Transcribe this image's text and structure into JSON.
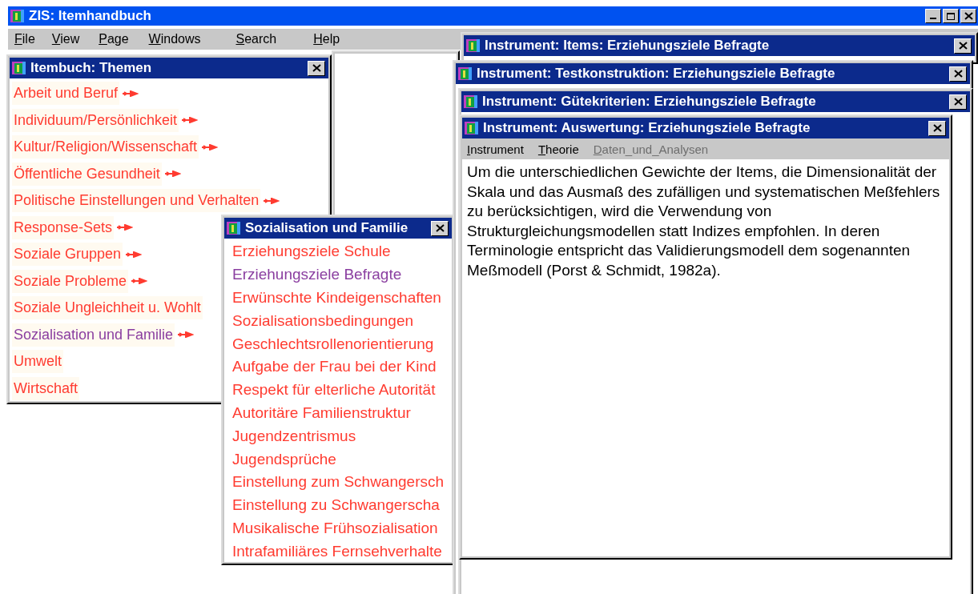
{
  "app": {
    "title": "ZIS: Itemhandbuch"
  },
  "menu": [
    "File",
    "View",
    "Page",
    "Windows",
    "Search",
    "Help"
  ],
  "themes_window": {
    "title": "Itembuch: Themen",
    "items": [
      {
        "label": "Arbeit und Beruf",
        "selected": false,
        "has_submenu": true
      },
      {
        "label": "Individuum/Persönlichkeit",
        "selected": false,
        "has_submenu": true
      },
      {
        "label": "Kultur/Religion/Wissenschaft",
        "selected": false,
        "has_submenu": true
      },
      {
        "label": "Öffentliche Gesundheit",
        "selected": false,
        "has_submenu": true
      },
      {
        "label": "Politische Einstellungen und Verhalten",
        "selected": false,
        "has_submenu": true
      },
      {
        "label": "Response-Sets",
        "selected": false,
        "has_submenu": true
      },
      {
        "label": "Soziale Gruppen",
        "selected": false,
        "has_submenu": true
      },
      {
        "label": "Soziale Probleme",
        "selected": false,
        "has_submenu": true
      },
      {
        "label": "Soziale Ungleichheit u. Wohlt",
        "selected": false,
        "has_submenu": false
      },
      {
        "label": "Sozialisation und Familie",
        "selected": true,
        "has_submenu": true
      },
      {
        "label": "Umwelt",
        "selected": false,
        "has_submenu": false
      },
      {
        "label": "Wirtschaft",
        "selected": false,
        "has_submenu": false
      }
    ]
  },
  "topic_window": {
    "title": "Sozialisation und Familie",
    "items": [
      {
        "label": "Erziehungsziele Schule",
        "selected": false
      },
      {
        "label": "Erziehungsziele Befragte",
        "selected": true
      },
      {
        "label": "Erwünschte Kindeigenschaften",
        "selected": false
      },
      {
        "label": "Sozialisationsbedingungen",
        "selected": false
      },
      {
        "label": "Geschlechtsrollenorientierung",
        "selected": false
      },
      {
        "label": "Aufgabe der Frau bei der Kind",
        "selected": false
      },
      {
        "label": "Respekt für elterliche Autorität",
        "selected": false
      },
      {
        "label": "Autoritäre Familienstruktur",
        "selected": false
      },
      {
        "label": "Jugendzentrismus",
        "selected": false
      },
      {
        "label": "Jugendsprüche",
        "selected": false
      },
      {
        "label": "Einstellung zum Schwangersch",
        "selected": false
      },
      {
        "label": "Einstellung zu Schwangerscha",
        "selected": false
      },
      {
        "label": "Musikalische Frühsozialisation",
        "selected": false
      },
      {
        "label": "Intrafamiliäres Fernsehverhalte",
        "selected": false
      }
    ]
  },
  "instrument_windows": [
    {
      "title": "Instrument: Items: Erziehungsziele Befragte"
    },
    {
      "title": "Instrument: Testkonstruktion: Erziehungsziele Befragte"
    },
    {
      "title": "Instrument: Gütekriterien: Erziehungsziele Befragte"
    }
  ],
  "active_window": {
    "title": "Instrument: Auswertung: Erziehungsziele Befragte",
    "tabs": [
      {
        "label": "Instrument",
        "disabled": false
      },
      {
        "label": "Theorie",
        "disabled": false
      },
      {
        "label": "Daten_und_Analysen",
        "disabled": true
      }
    ],
    "text": "Um die unterschiedlichen Gewichte der Items, die Dimensionalität der Skala und das Ausmaß des zufälligen und systematischen Meßfehlers zu berücksichtigen, wird die Verwendung von Strukturgleichungsmodellen statt Indizes empfohlen. In deren Terminologie entspricht das Validierungsmodell dem sogenannten Meßmodell (Porst & Schmidt, 1982a)."
  }
}
